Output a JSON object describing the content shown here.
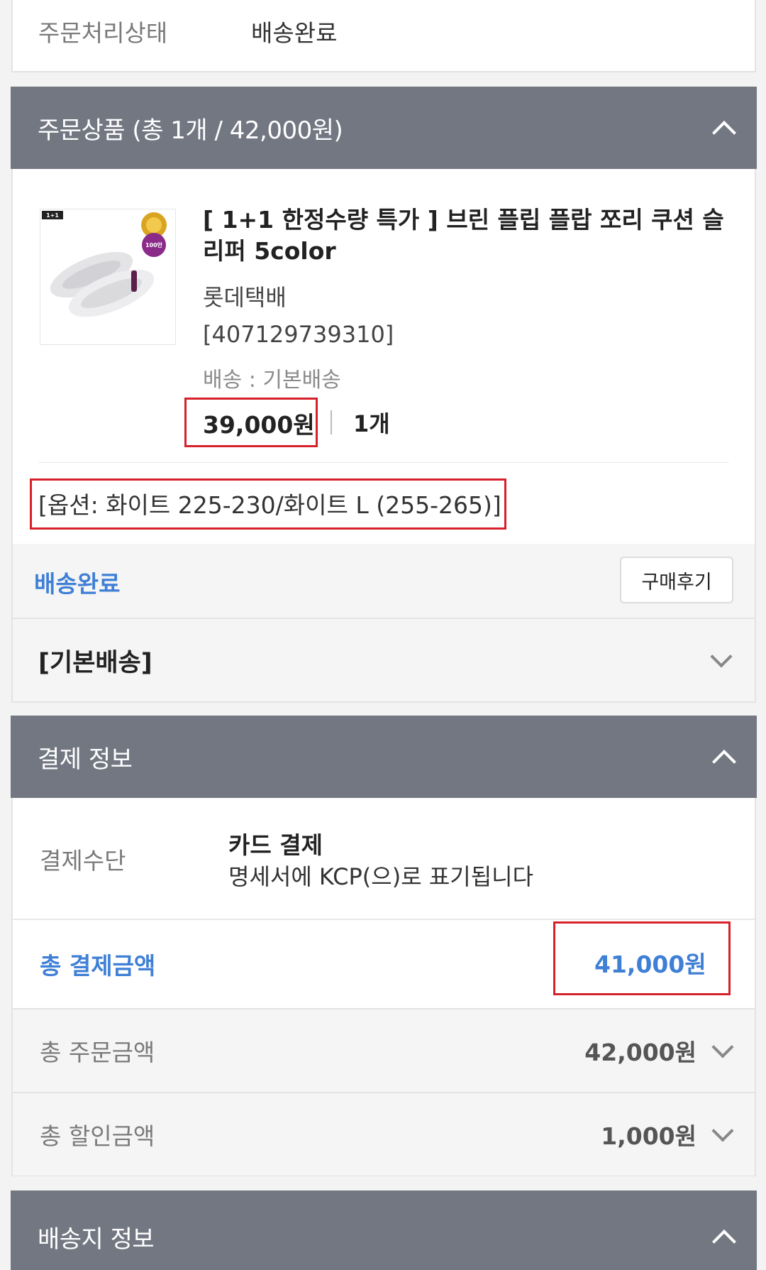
{
  "status": {
    "label": "주문처리상태",
    "value": "배송완료"
  },
  "order_section": {
    "title": "주문상품 (총 1개 / 42,000원)"
  },
  "product": {
    "thumbnail_badge": "1+1",
    "thumbnail_medal_text": "100만",
    "title": "[ 1+1 한정수량 특가 ] 브린 플립 플랍 쪼리 쿠션 슬리퍼 5color",
    "courier": "롯데택배",
    "tracking": "[407129739310]",
    "shipping": "배송 : 기본배송",
    "price": "39,000원",
    "quantity": "1개",
    "option": "[옵션: 화이트 225-230/화이트 L (255-265)]",
    "delivery_status": "배송완료",
    "review_button": "구매후기",
    "shipping_group": "[기본배송]"
  },
  "payment_section": {
    "title": "결제 정보",
    "method_label": "결제수단",
    "method_value": "카드 결제",
    "method_note": "명세서에 KCP(으)로 표기됩니다",
    "total_label": "총 결제금액",
    "total_value": "41,000원",
    "order_total_label": "총 주문금액",
    "order_total_value": "42,000원",
    "discount_label": "총 할인금액",
    "discount_value": "1,000원"
  },
  "shipping_section": {
    "title": "배송지 정보"
  },
  "colors": {
    "header_bg": "#737782",
    "accent_blue": "#3f7fd6",
    "highlight_red": "#d6212b"
  }
}
